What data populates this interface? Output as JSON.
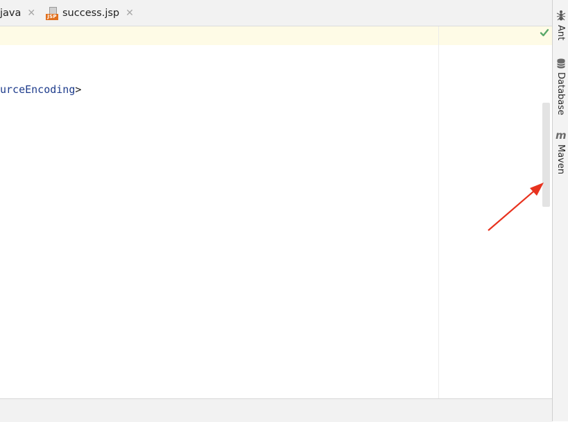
{
  "tabs": [
    {
      "label": "java",
      "close": "✕"
    },
    {
      "label": "success.jsp",
      "close": "✕",
      "badge": "JSP"
    }
  ],
  "editor": {
    "code_text": "urceEncoding",
    "code_suffix": ">"
  },
  "tool_windows": {
    "ant": "Ant",
    "database": "Database",
    "maven": "Maven",
    "maven_icon": "m"
  },
  "colors": {
    "accent_arrow": "#e8321e",
    "check": "#59a869",
    "xml_tag": "#1e3c8c",
    "highlight_band": "#fefbe6"
  },
  "icons": [
    "jsp-file-icon",
    "close-icon",
    "check-icon",
    "ant-icon",
    "database-icon",
    "maven-icon"
  ]
}
